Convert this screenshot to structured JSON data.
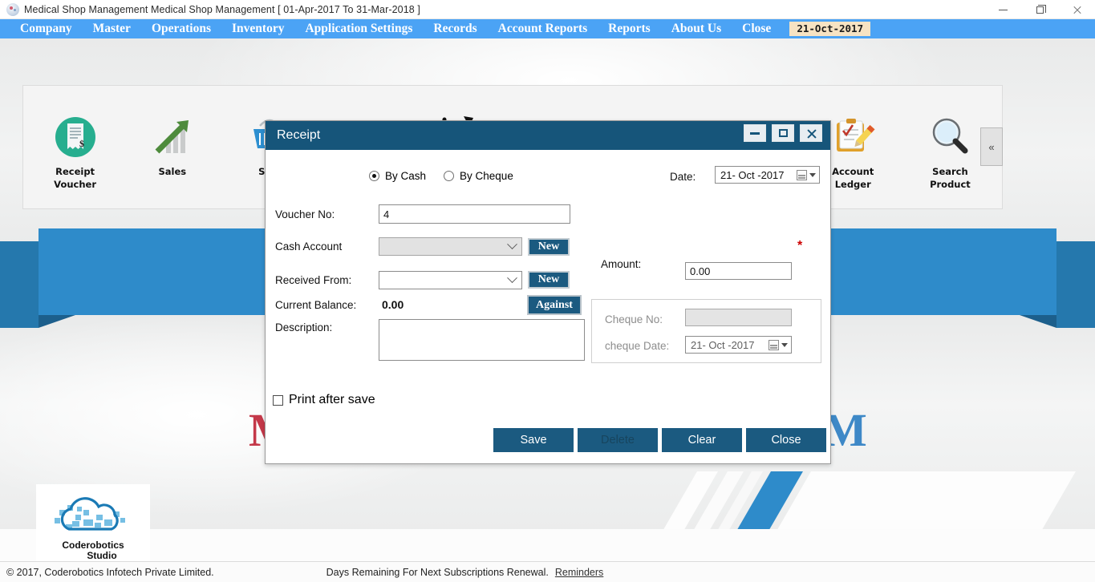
{
  "window": {
    "title": "Medical Shop Management Medical Shop Management [ 01-Apr-2017 To 31-Mar-2018 ]",
    "app_icon": "app-logo-icon",
    "controls": {
      "minimize": "minimize-icon",
      "maximize": "maximize-icon",
      "close": "close-icon"
    }
  },
  "menubar": {
    "items": [
      {
        "label": "Company"
      },
      {
        "label": "Master"
      },
      {
        "label": "Operations"
      },
      {
        "label": "Inventory"
      },
      {
        "label": "Application Settings"
      },
      {
        "label": "Records"
      },
      {
        "label": "Account Reports"
      },
      {
        "label": "Reports"
      },
      {
        "label": "About Us"
      },
      {
        "label": "Close"
      }
    ],
    "date_badge": "21-Oct-2017",
    "badge_bg": "#f7e3c3",
    "bar_bg": "#4ba3f5"
  },
  "toolbar": {
    "collapse_label": "«",
    "items": [
      {
        "label": "Receipt\nVoucher",
        "icon": "receipt-voucher-icon"
      },
      {
        "label": "Sales",
        "icon": "sales-growth-icon"
      },
      {
        "label": "Sale",
        "icon": "sale-basket-icon"
      },
      {
        "label": "",
        "icon": "purchase-cart-icon"
      },
      {
        "label": "",
        "icon": "sale-return-cart-icon"
      },
      {
        "label": "",
        "icon": "medicine-pills-icon"
      },
      {
        "label": "",
        "icon": "calendar-icon"
      },
      {
        "label": "",
        "icon": "report-chart-icon"
      },
      {
        "label": "Account\nLedger",
        "icon": "account-ledger-icon"
      },
      {
        "label": "Search\nProduct",
        "icon": "search-product-icon"
      }
    ]
  },
  "background": {
    "watermark_left": "M",
    "watermark_right": "M",
    "ribbon_color": "#2e8bca",
    "logo": {
      "line1": "Coderobotics",
      "line2": "Studio"
    }
  },
  "dialog": {
    "title": "Receipt",
    "titlebar_color": "#16557a",
    "controls": {
      "minimize": "minimize-icon",
      "maximize": "maximize-icon",
      "close": "close-icon"
    },
    "payment_mode": {
      "options": [
        {
          "label": "By Cash",
          "selected": true
        },
        {
          "label": "By Cheque",
          "selected": false
        }
      ]
    },
    "date": {
      "label": "Date:",
      "value": "21- Oct -2017"
    },
    "voucher_no": {
      "label": "Voucher No:",
      "value": "4"
    },
    "cash_account": {
      "label": "Cash Account",
      "value": "",
      "new_button": "New"
    },
    "received_from": {
      "label": "Received From:",
      "value": "",
      "new_button": "New"
    },
    "current_balance": {
      "label": "Current Balance:",
      "value": "0.00"
    },
    "against_button": "Against",
    "description": {
      "label": "Description:",
      "value": ""
    },
    "amount": {
      "label": "Amount:",
      "value": "0.00",
      "required_marker": "*",
      "marker_color": "#cc0000"
    },
    "cheque": {
      "no_label": "Cheque No:",
      "no_value": "",
      "date_label": "cheque Date:",
      "date_value": "21- Oct -2017"
    },
    "print_after_save": {
      "label": "Print after save",
      "checked": false
    },
    "buttons": [
      {
        "label": "Save",
        "enabled": true
      },
      {
        "label": "Delete",
        "enabled": false
      },
      {
        "label": "Clear",
        "enabled": true
      },
      {
        "label": "Close",
        "enabled": true
      }
    ]
  },
  "statusbar": {
    "copyright": "© 2017, Coderobotics Infotech Private Limited.",
    "days_text": "Days Remaining For Next Subscriptions Renewal.",
    "reminders_link": "Reminders"
  }
}
